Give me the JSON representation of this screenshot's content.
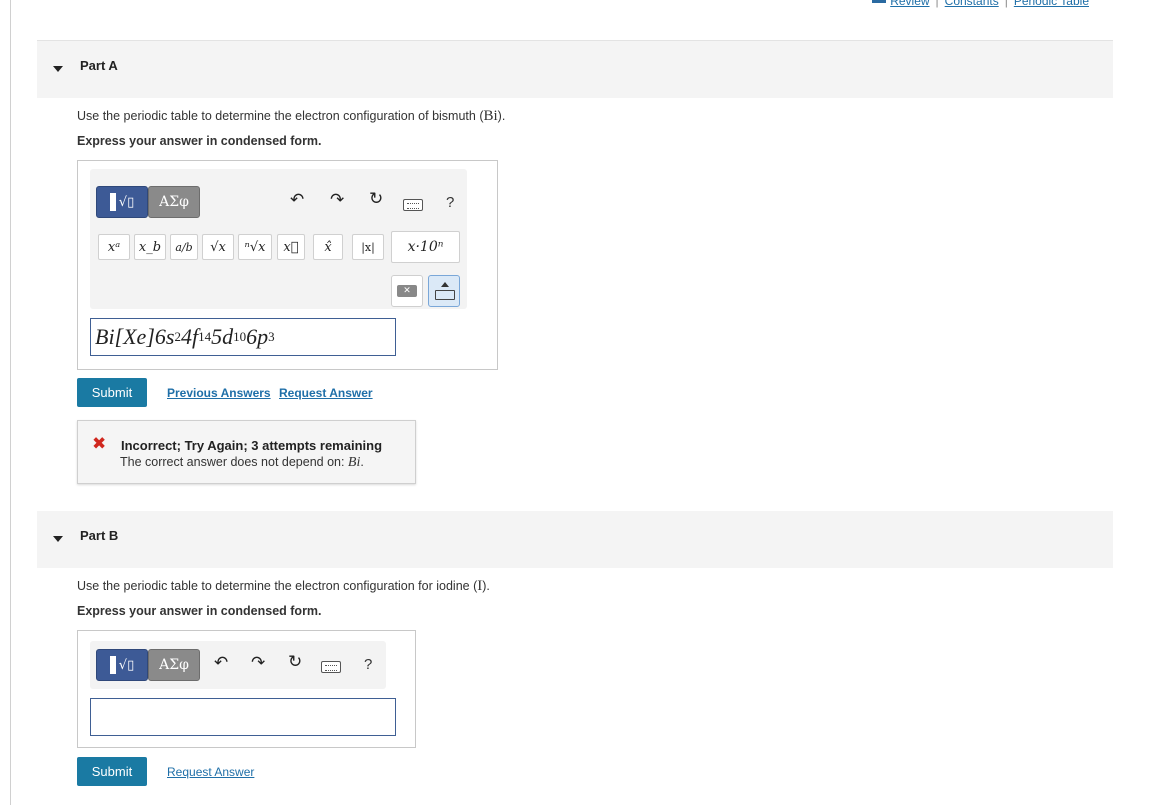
{
  "top_links": [
    "Review",
    "Constants",
    "Periodic Table"
  ],
  "part_a": {
    "title": "Part A",
    "question_prefix": "Use the periodic table to determine the electron configuration of bismuth (",
    "question_symbol": "Bi",
    "question_suffix": ").",
    "instruction": "Express your answer in condensed form.",
    "toolbar": {
      "templates_label": "√▯",
      "symbols_label": "ΑΣφ",
      "help_label": "?"
    },
    "keys": [
      "xᵃ",
      "x_b",
      "a/b",
      "√x",
      "ⁿ√x",
      "x⃗",
      "x̂",
      "|x|"
    ],
    "sci_key": "x·10ⁿ",
    "answer": {
      "base": "Bi[Xe]6s",
      "e1": "2",
      "p2": "4f",
      "e2": "14",
      "p3": "5d",
      "e3": "10",
      "p4": "6p",
      "e4": "3"
    },
    "submit_label": "Submit",
    "previous_answers_label": "Previous Answers",
    "request_answer_label": "Request Answer",
    "feedback": {
      "headline": "Incorrect; Try Again; 3 attempts remaining",
      "detail_prefix": "The correct answer does not depend on: ",
      "detail_symbol": "Bi",
      "detail_suffix": "."
    }
  },
  "part_b": {
    "title": "Part B",
    "question_prefix": "Use the periodic table to determine the electron configuration for iodine (",
    "question_symbol": "I",
    "question_suffix": ").",
    "instruction": "Express your answer in condensed form.",
    "toolbar": {
      "templates_label": "√▯",
      "symbols_label": "ΑΣφ",
      "help_label": "?"
    },
    "answer_value": "",
    "submit_label": "Submit",
    "request_answer_label": "Request Answer"
  }
}
